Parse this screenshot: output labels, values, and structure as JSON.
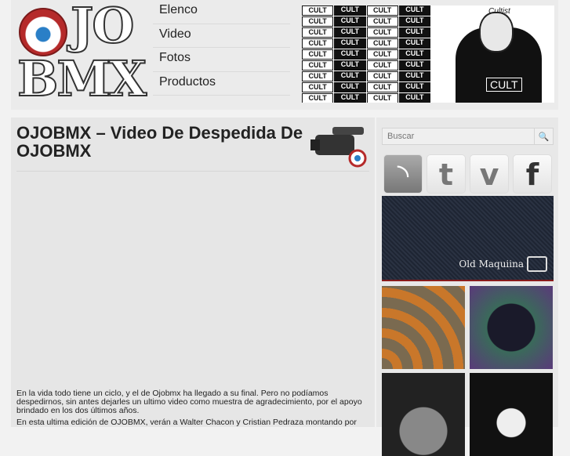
{
  "header": {
    "logo_text": "OJO BMX",
    "nav": [
      {
        "label": "Elenco"
      },
      {
        "label": "Video"
      },
      {
        "label": "Fotos"
      },
      {
        "label": "Productos"
      }
    ],
    "banner": {
      "pattern_text": "CULT",
      "signature": "Cultist",
      "shirt_text": "CULT"
    }
  },
  "post": {
    "title": "OJOBMX – Video De Despedida De OJOBMX",
    "paragraphs": [
      "En la vida todo tiene un ciclo, y el de Ojobmx ha llegado a su final. Pero no podíamos despedirnos, sin antes dejarles un ultimo video como muestra de agradecimiento, por el apoyo brindado en los dos últimos años.",
      "En esta ultima edición de OJOBMX, verán a Walter Chacon y Cristian Pedraza montando por"
    ]
  },
  "sidebar": {
    "search_placeholder": "Buscar",
    "search_button": "🔍",
    "social": [
      {
        "name": "rss",
        "glyph": "◝"
      },
      {
        "name": "twitter",
        "glyph": "t"
      },
      {
        "name": "vimeo",
        "glyph": "v"
      },
      {
        "name": "facebook",
        "glyph": "f"
      }
    ],
    "ad_old_maquina": "Old Maquiina"
  }
}
